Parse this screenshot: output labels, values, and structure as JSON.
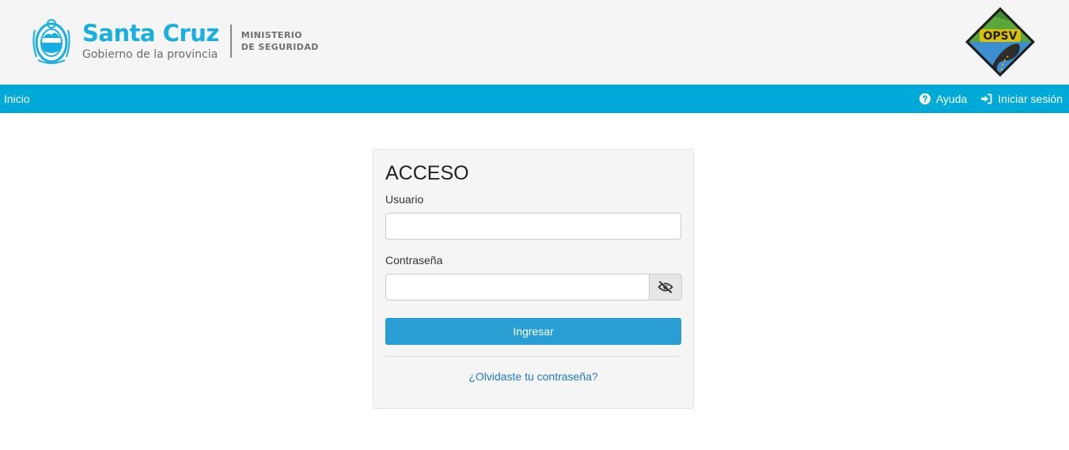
{
  "header": {
    "brand_title": "Santa Cruz",
    "brand_subtitle": "Gobierno de la provincia",
    "ministry_line1": "MINISTERIO",
    "ministry_line2": "DE SEGURIDAD",
    "right_logo_text": "OPSV"
  },
  "navbar": {
    "home_label": "Inicio",
    "help_label": "Ayuda",
    "login_label": "Iniciar sesión"
  },
  "login": {
    "title": "ACCESO",
    "user_label": "Usuario",
    "user_value": "",
    "password_label": "Contraseña",
    "password_value": "",
    "submit_label": "Ingresar",
    "forgot_label": "¿Olvidaste tu contraseña?"
  },
  "colors": {
    "brand": "#19aee0",
    "navbar": "#00aad8",
    "button": "#2a9fd6",
    "link": "#1f7ac4"
  },
  "icons": {
    "help": "question-circle-icon",
    "login": "sign-in-icon",
    "toggle": "eye-slash-icon"
  }
}
